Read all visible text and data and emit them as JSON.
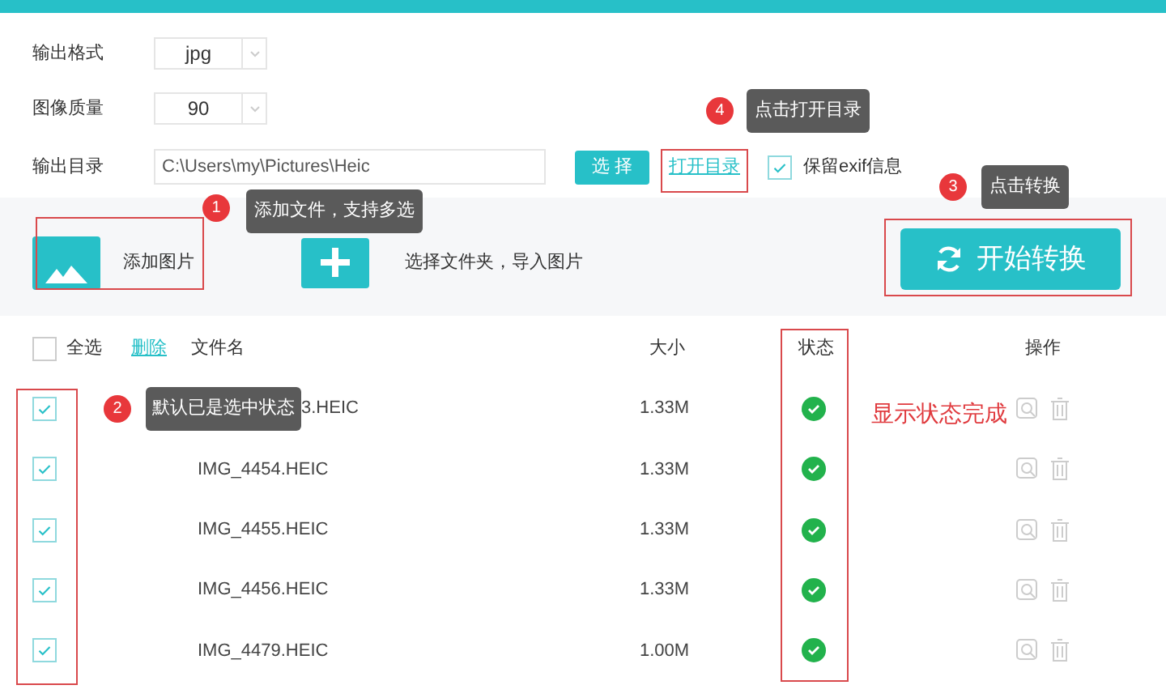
{
  "settings": {
    "format": {
      "label": "输出格式",
      "value": "jpg"
    },
    "quality": {
      "label": "图像质量",
      "value": "90"
    },
    "output_dir": {
      "label": "输出目录",
      "value": "C:\\Users\\my\\Pictures\\Heic"
    },
    "choose_button": "选 择",
    "open_folder_link": "打开目录",
    "keep_exif": {
      "label": "保留exif信息",
      "checked": true
    }
  },
  "actions": {
    "add_images": "添加图片",
    "import_folder": "选择文件夹，导入图片",
    "start_button": "开始转换"
  },
  "table": {
    "select_all": {
      "label": "全选",
      "checked": false
    },
    "delete_link": "删除",
    "columns": [
      "文件名",
      "大小",
      "状态",
      "操作"
    ],
    "rows": [
      {
        "checked": true,
        "name": "3.HEIC",
        "size": "1.33M",
        "completed": true,
        "note": {
          "number": "2",
          "text": "默认已是选中状态"
        }
      },
      {
        "checked": true,
        "name": "IMG_4454.HEIC",
        "size": "1.33M",
        "completed": true
      },
      {
        "checked": true,
        "name": "IMG_4455.HEIC",
        "size": "1.33M",
        "completed": true
      },
      {
        "checked": true,
        "name": "IMG_4456.HEIC",
        "size": "1.33M",
        "completed": true
      },
      {
        "checked": true,
        "name": "IMG_4479.HEIC",
        "size": "1.00M",
        "completed": true
      }
    ]
  },
  "annotations": [
    {
      "kind": "callout",
      "number": "1",
      "text": "添加文件，支持多选"
    },
    {
      "kind": "callout",
      "number": "3",
      "text": "点击转换"
    },
    {
      "kind": "callout",
      "number": "4",
      "text": "点击打开目录"
    },
    {
      "kind": "label",
      "text": "显示状态完成"
    }
  ]
}
